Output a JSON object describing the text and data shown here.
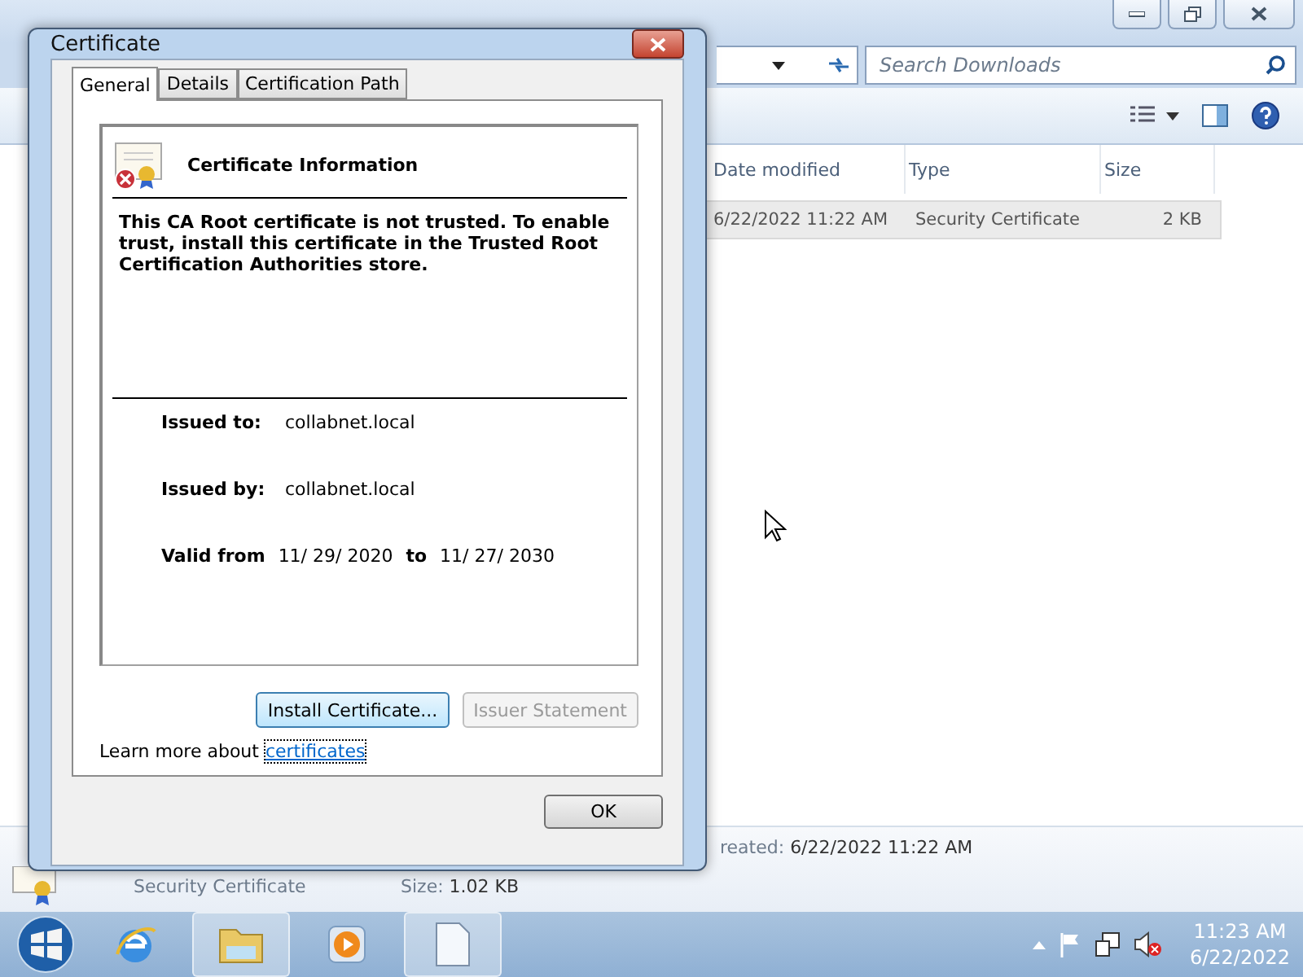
{
  "explorer": {
    "search": {
      "placeholder": "Search Downloads"
    },
    "columns": [
      "Date modified",
      "Type",
      "Size"
    ],
    "rows": [
      {
        "date": "6/22/2022 11:22 AM",
        "type": "Security Certificate",
        "size": "2 KB",
        "selected": true
      }
    ],
    "details": {
      "created_label": "reated:",
      "created": "6/22/2022 11:22 AM",
      "type": "Security Certificate",
      "size_label": "Size:",
      "size": "1.02 KB"
    }
  },
  "dialog": {
    "title": "Certificate",
    "tabs": [
      {
        "label": "General",
        "selected": true
      },
      {
        "label": "Details",
        "selected": false
      },
      {
        "label": "Certification Path",
        "selected": false
      }
    ],
    "heading": "Certificate Information",
    "message": "This CA Root certificate is not trusted. To enable trust, install this certificate in the Trusted Root Certification Authorities store.",
    "issued_to_label": "Issued to:",
    "issued_to": "collabnet.local",
    "issued_by_label": "Issued by:",
    "issued_by": "collabnet.local",
    "valid_from_label": "Valid from",
    "valid_from": "11/ 29/ 2020",
    "valid_to_label": "to",
    "valid_to": "11/ 27/ 2030",
    "buttons": [
      {
        "label": "Install Certificate...",
        "disabled": false
      },
      {
        "label": "Issuer Statement",
        "disabled": true
      }
    ],
    "learn_more": "Learn more about",
    "link": "certificates",
    "ok": "OK"
  },
  "taskbar": {
    "time": "11:23 AM",
    "date": "6/22/2022"
  }
}
